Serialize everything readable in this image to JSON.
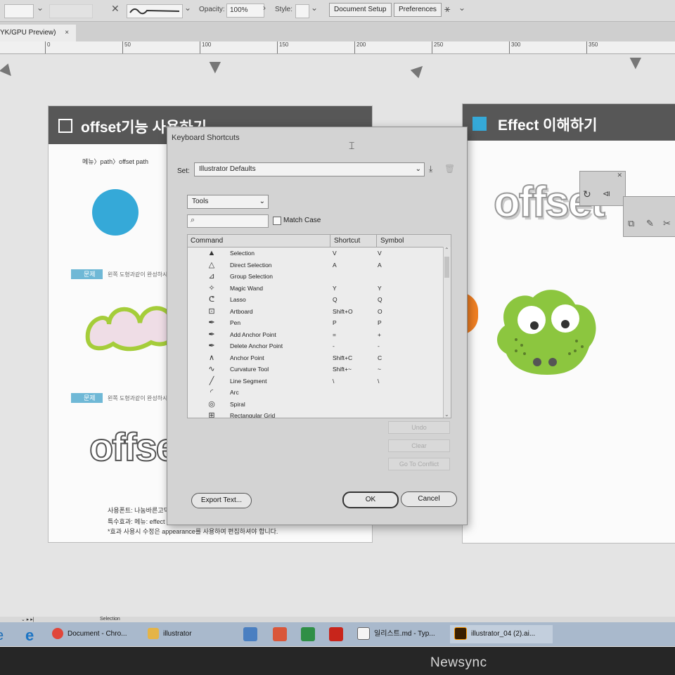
{
  "toolbar": {
    "opacity_label": "Opacity:",
    "opacity_value": "100%",
    "style_label": "Style:",
    "document_setup": "Document Setup",
    "preferences": "Preferences"
  },
  "document_tab": {
    "title": "YK/GPU Preview)",
    "close": "×"
  },
  "ruler": {
    "ticks": [
      "0",
      "50",
      "100",
      "150",
      "200",
      "250",
      "300",
      "350"
    ]
  },
  "slide_left": {
    "title": "offset기능 사용하기",
    "menu_path": "메뉴〉path〉offset path",
    "tag1": "문제",
    "tag1_note": "왼쪽 도형과같이 완성하시",
    "tag2": "문제",
    "tag2_note": "왼쪽 도형과같이 완성하시",
    "offset_word": "offse",
    "font_note": "사용폰트: 나눔바른고딕",
    "effect_note": "특수효과: 메뉴: effect 〉",
    "footnote": "*효과 사용시 수정은 appearance를 사용하여 편집하셔야 합니다."
  },
  "slide_right": {
    "title": "Effect 이해하기",
    "offset_word": "offset"
  },
  "dialog": {
    "title": "Keyboard Shortcuts",
    "set_label": "Set:",
    "set_value": "Illustrator Defaults",
    "category": "Tools",
    "match_case": "Match Case",
    "col_command": "Command",
    "col_shortcut": "Shortcut",
    "col_symbol": "Symbol",
    "rows": [
      {
        "icon": "selection-tool-icon",
        "glyph": "▲",
        "command": "Selection",
        "shortcut": "V",
        "symbol": "V"
      },
      {
        "icon": "direct-selection-tool-icon",
        "glyph": "△",
        "command": "Direct Selection",
        "shortcut": "A",
        "symbol": "A"
      },
      {
        "icon": "group-selection-tool-icon",
        "glyph": "⊿",
        "command": "Group Selection",
        "shortcut": "",
        "symbol": ""
      },
      {
        "icon": "magic-wand-tool-icon",
        "glyph": "✧",
        "command": "Magic Wand",
        "shortcut": "Y",
        "symbol": "Y"
      },
      {
        "icon": "lasso-tool-icon",
        "glyph": "ᕦ",
        "command": "Lasso",
        "shortcut": "Q",
        "symbol": "Q"
      },
      {
        "icon": "artboard-tool-icon",
        "glyph": "⊡",
        "command": "Artboard",
        "shortcut": "Shift+O",
        "symbol": "O"
      },
      {
        "icon": "pen-tool-icon",
        "glyph": "✒",
        "command": "Pen",
        "shortcut": "P",
        "symbol": "P"
      },
      {
        "icon": "add-anchor-point-tool-icon",
        "glyph": "✒",
        "command": "Add Anchor Point",
        "shortcut": "=",
        "symbol": "+"
      },
      {
        "icon": "delete-anchor-point-tool-icon",
        "glyph": "✒",
        "command": "Delete Anchor Point",
        "shortcut": "-",
        "symbol": "-"
      },
      {
        "icon": "anchor-point-tool-icon",
        "glyph": "∧",
        "command": "Anchor Point",
        "shortcut": "Shift+C",
        "symbol": "C"
      },
      {
        "icon": "curvature-tool-icon",
        "glyph": "∿",
        "command": "Curvature Tool",
        "shortcut": "Shift+~",
        "symbol": "~"
      },
      {
        "icon": "line-segment-tool-icon",
        "glyph": "╱",
        "command": "Line Segment",
        "shortcut": "\\",
        "symbol": "\\"
      },
      {
        "icon": "arc-tool-icon",
        "glyph": "◜",
        "command": "Arc",
        "shortcut": "",
        "symbol": ""
      },
      {
        "icon": "spiral-tool-icon",
        "glyph": "◎",
        "command": "Spiral",
        "shortcut": "",
        "symbol": ""
      },
      {
        "icon": "rectangular-grid-tool-icon",
        "glyph": "⊞",
        "command": "Rectangular Grid",
        "shortcut": "",
        "symbol": ""
      }
    ],
    "undo": "Undo",
    "clear": "Clear",
    "go_to_conflict": "Go To Conflict",
    "export_text": "Export Text...",
    "ok": "OK",
    "cancel": "Cancel"
  },
  "status_bar": {
    "tool": "Selection"
  },
  "taskbar": {
    "items": [
      {
        "label": "Document - Chro...",
        "color": "#e0463a"
      },
      {
        "label": "illustrator",
        "color": "#e5b447"
      },
      {
        "label": "일리스트.md - Typ...",
        "color": "#f4f4f4"
      },
      {
        "label": "illustrator_04 (2).ai...",
        "color": "#3a1f00"
      }
    ]
  },
  "watermark": "Newsync",
  "colors": {
    "accent_blue": "#35a9d8",
    "slide_header": "#575757",
    "frog_green": "#8cc63f",
    "tag_blue": "#6fb8d6"
  }
}
